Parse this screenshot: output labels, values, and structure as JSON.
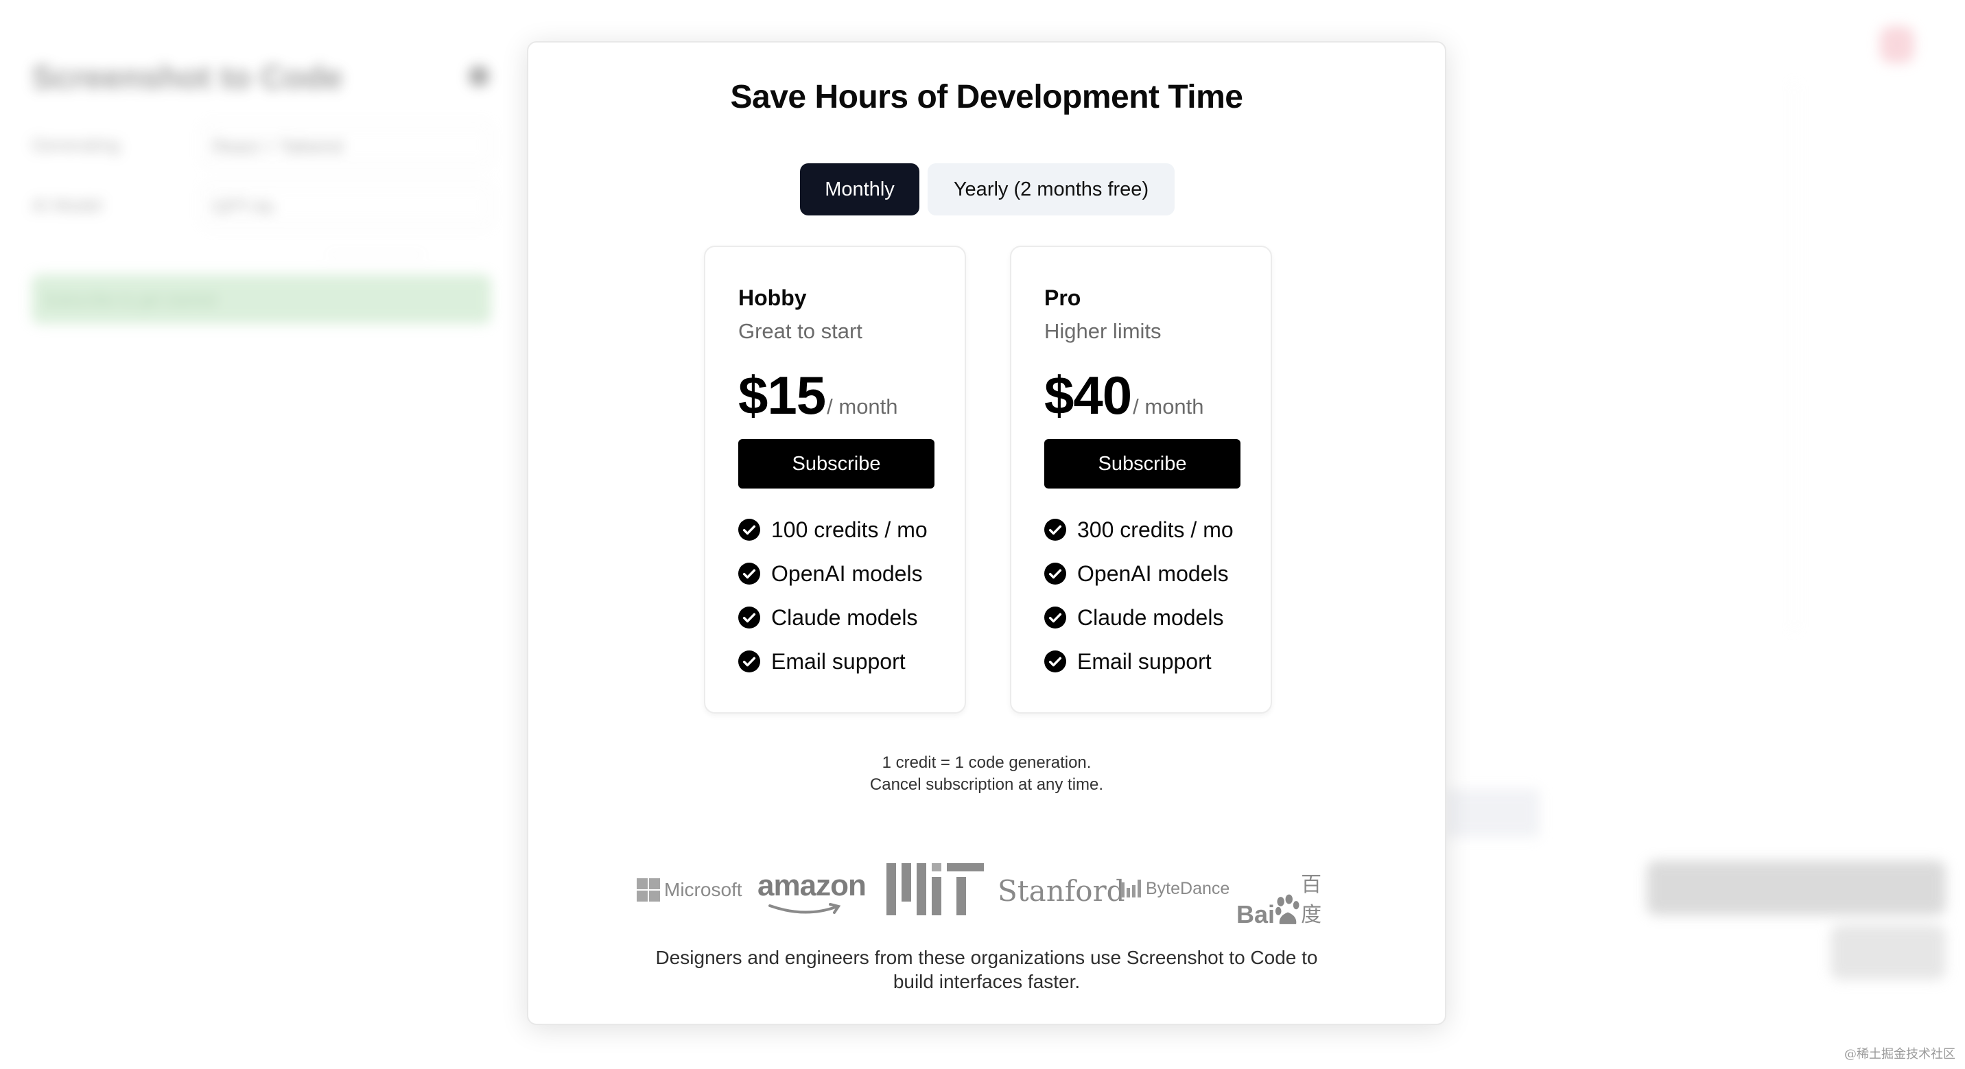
{
  "background": {
    "app_title": "Screenshot to Code",
    "stack_label": "Generating",
    "stack_value": "React + Tailwind",
    "model_label": "AI Model",
    "model_value": "GPT-4o",
    "cta_label": "Subscribe to get started"
  },
  "modal": {
    "title": "Save Hours of Development Time",
    "toggle": {
      "monthly": "Monthly",
      "yearly": "Yearly (2 months free)"
    },
    "plans": [
      {
        "name": "Hobby",
        "tagline": "Great to start",
        "price": "$15",
        "period": "/ month",
        "cta": "Subscribe",
        "features": [
          "100 credits / mo",
          "OpenAI models",
          "Claude models",
          "Email support"
        ]
      },
      {
        "name": "Pro",
        "tagline": "Higher limits",
        "price": "$40",
        "period": "/ month",
        "cta": "Subscribe",
        "features": [
          "300 credits / mo",
          "OpenAI models",
          "Claude models",
          "Email support"
        ]
      }
    ],
    "note_line1": "1 credit = 1 code generation.",
    "note_line2": "Cancel subscription at any time.",
    "logos": {
      "microsoft": "Microsoft",
      "amazon": "amazon",
      "stanford": "Stanford",
      "bytedance": "ByteDance",
      "baidu_latin": "Bai",
      "baidu_cjk": "百度"
    },
    "footer_line1": "Designers and engineers from these organizations use Screenshot to Code to",
    "footer_line2": "build interfaces faster."
  },
  "watermark": "@稀土掘金技术社区",
  "colors": {
    "toggle_active": "#0f1423",
    "toggle_inactive": "#f0f3f7",
    "subscribe_bg": "#000000",
    "muted_text": "#6b6b6b",
    "logo_gray": "#8c8c8c"
  },
  "icons": {
    "feature_check": "check-circle-icon",
    "settings": "gear-icon"
  }
}
